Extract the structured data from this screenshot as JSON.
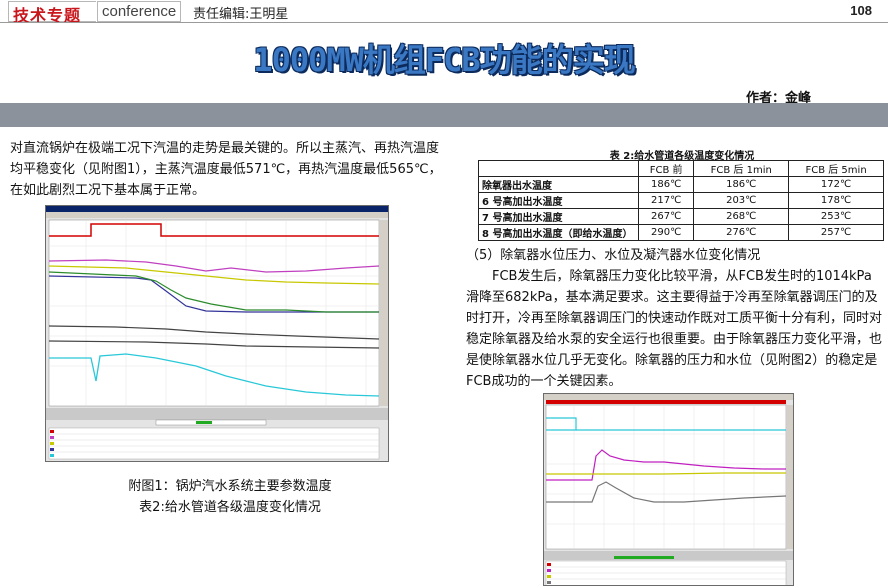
{
  "header": {
    "section": "技术专题",
    "conference": "conference",
    "editor": "责任编辑:王明星",
    "page_number": "108"
  },
  "title": "1000MW机组FCB功能的实现",
  "author": "作者：金峰",
  "intro_paragraph": "对直流锅炉在极端工况下汽温的走势是最关键的。所以主蒸汽、再热汽温度均平稳变化（见附图1），主蒸汽温度最低571℃，再热汽温度最低565℃，在如此剧烈工况下基本属于正常。",
  "figure1": {
    "caption": "附图1：锅炉汽水系统主要参数温度",
    "table_ref": "表2:给水管道各级温度变化情况"
  },
  "table": {
    "title": "表 2:给水管道各级温度变化情况",
    "headers": [
      "",
      "FCB 前",
      "FCB 后 1min",
      "FCB 后 5min"
    ],
    "rows": [
      [
        "除氧器出水温度",
        "186℃",
        "186℃",
        "172℃"
      ],
      [
        "6 号高加出水温度",
        "217℃",
        "203℃",
        "178℃"
      ],
      [
        "7 号高加出水温度",
        "267℃",
        "268℃",
        "253℃"
      ],
      [
        "8 号高加出水温度（即给水温度）",
        "290℃",
        "276℃",
        "257℃"
      ]
    ]
  },
  "section5": {
    "heading": "（5）除氧器水位压力、水位及凝汽器水位变化情况",
    "body": "FCB发生后，除氧器压力变化比较平滑，从FCB发生时的1014kPa滑降至682kPa，基本满足要求。这主要得益于冷再至除氧器调压门的及时打开，冷再至除氧器调压门的快速动作既对工质平衡十分有利，同时对稳定除氧器及给水泵的安全运行也很重要。由于除氧器压力变化平滑，也是使除氧器水位几乎无变化。除氧器的压力和水位（见附图2）的稳定是FCB成功的一个关键因素。"
  },
  "colors": {
    "title_fill": "#3b78c4",
    "title_outline": "#0c2b5c",
    "section_red": "#c8161d",
    "band_gray": "#8c929b"
  }
}
